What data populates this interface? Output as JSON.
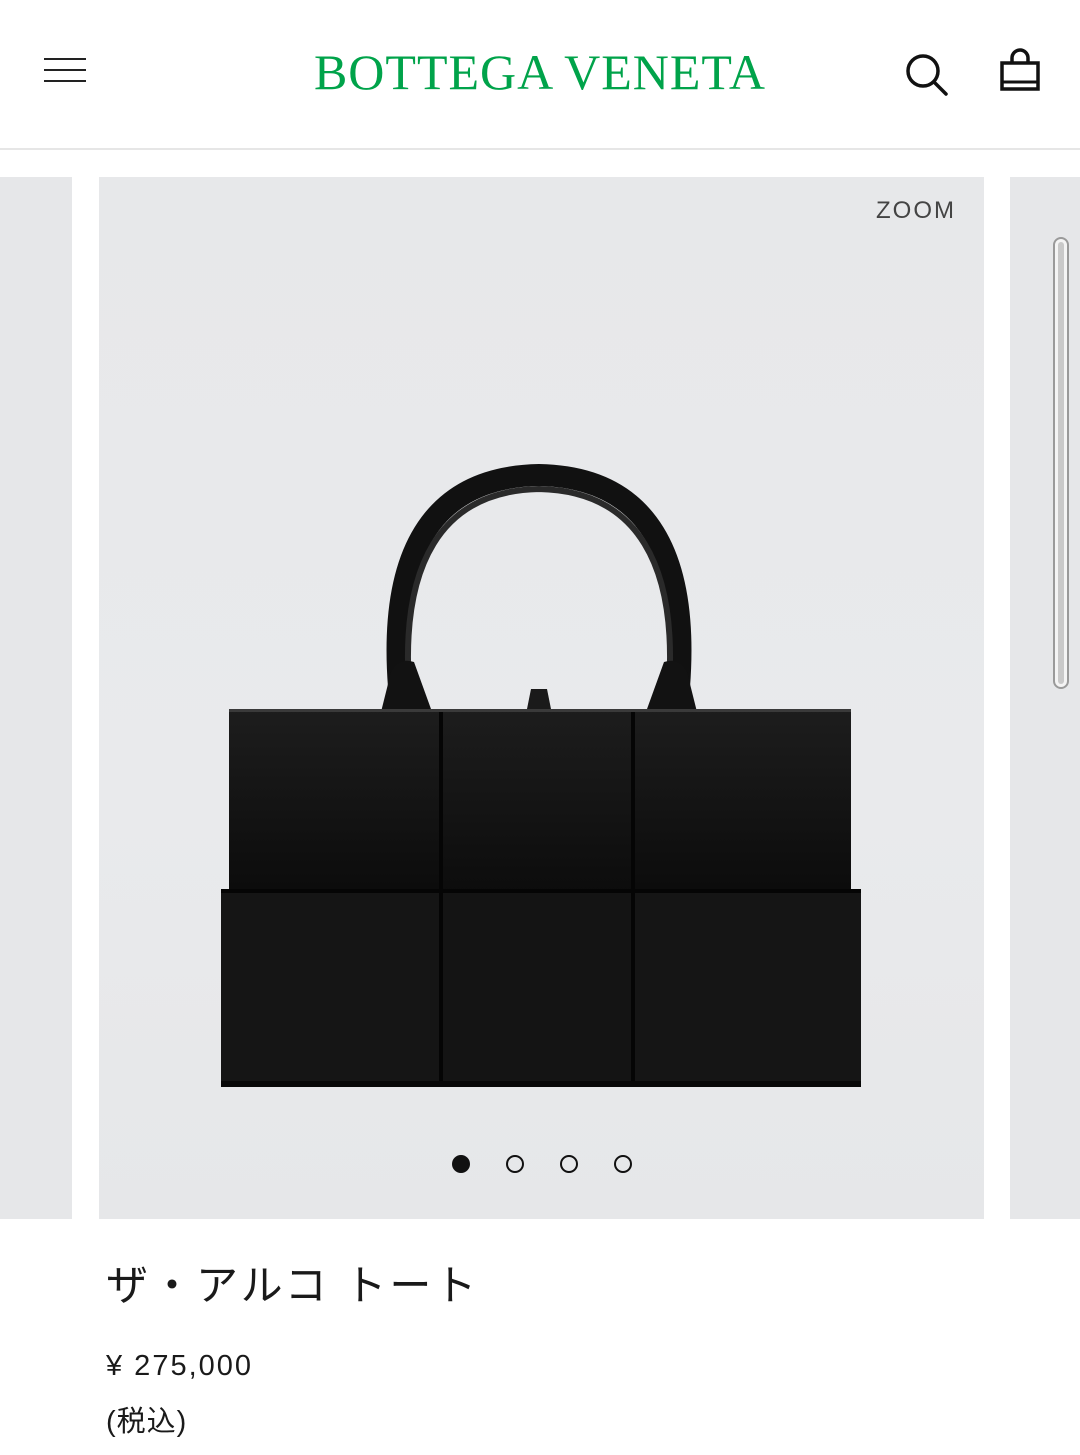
{
  "header": {
    "brand_name": "BOTTEGA VENETA",
    "brand_color": "#00a34a",
    "menu_icon": "hamburger-menu-icon",
    "search_icon": "search-icon",
    "cart_icon": "shopping-bag-icon"
  },
  "gallery": {
    "zoom_label": "ZOOM",
    "image_subject": "black woven leather tote bag",
    "slide_count": 4,
    "active_slide": 1
  },
  "product": {
    "name": "ザ・アルコ トート",
    "price": "¥ 275,000",
    "tax_note": "(税込)"
  }
}
